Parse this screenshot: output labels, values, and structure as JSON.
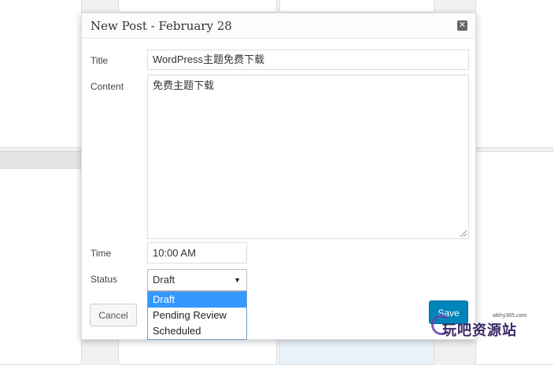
{
  "modal": {
    "title": "New Post - February 28",
    "close_icon": "close-icon"
  },
  "form": {
    "title_label": "Title",
    "title_value": "WordPress主题免费下载",
    "content_label": "Content",
    "content_value": "免费主题下载",
    "time_label": "Time",
    "time_value": "10:00 AM",
    "status_label": "Status",
    "status_value": "Draft",
    "status_options": [
      "Draft",
      "Pending Review",
      "Scheduled"
    ]
  },
  "buttons": {
    "cancel": "Cancel",
    "save": "Save"
  },
  "watermark": {
    "url": "wbhy365.com",
    "text": "玩吧资源站"
  },
  "colors": {
    "primary": "#0085ba",
    "selected_option": "#3399ff",
    "highlight_cell": "#e9f2fb"
  }
}
